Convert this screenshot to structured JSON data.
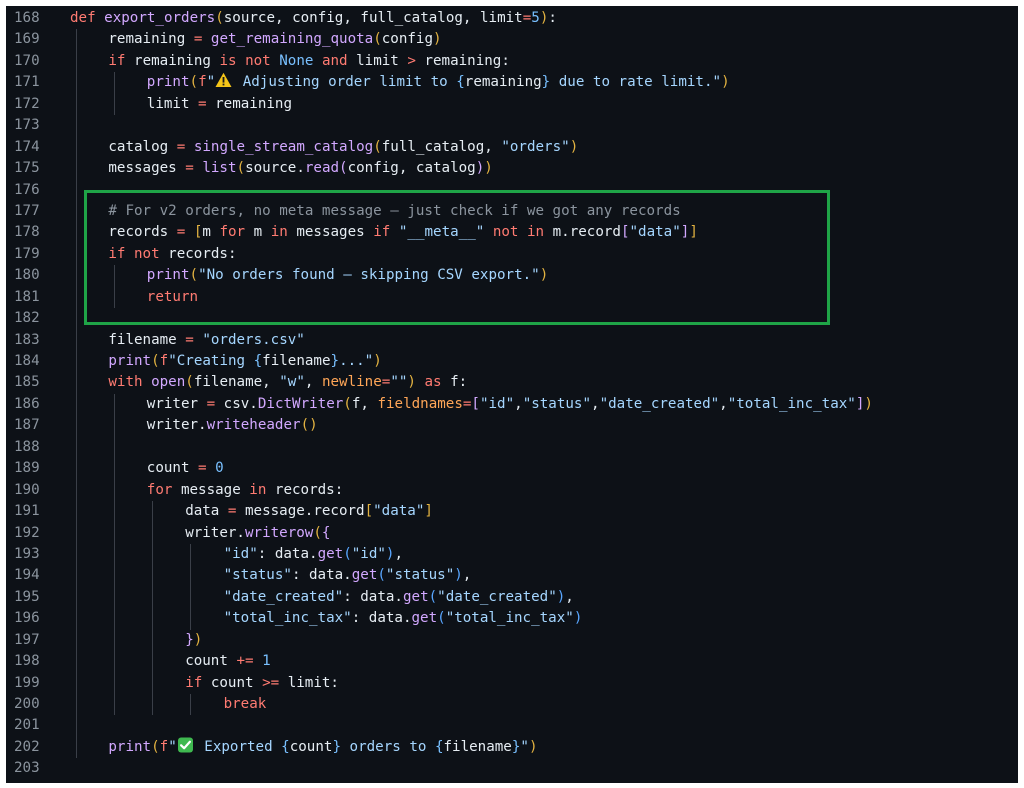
{
  "editor": {
    "theme_colors": {
      "background": "#0d1117",
      "keyword": "#ff7b72",
      "function": "#d2a8ff",
      "string": "#a5d6ff",
      "highlight_box": "#1fa447"
    },
    "lines": [
      {
        "n": "168",
        "indent": 0,
        "tokens": [
          [
            "kw",
            "def "
          ],
          [
            "fn",
            "export_orders"
          ],
          [
            "br1",
            "("
          ],
          [
            "",
            "source, config, full_catalog, limit"
          ],
          [
            "kw",
            "="
          ],
          [
            "num",
            "5"
          ],
          [
            "br1",
            ")"
          ],
          [
            "",
            ":"
          ]
        ]
      },
      {
        "n": "169",
        "indent": 1,
        "tokens": [
          [
            "",
            "remaining "
          ],
          [
            "kw",
            "="
          ],
          [
            "fn",
            " get_remaining_quota"
          ],
          [
            "br1",
            "("
          ],
          [
            "",
            "config"
          ],
          [
            "br1",
            ")"
          ]
        ]
      },
      {
        "n": "170",
        "indent": 1,
        "tokens": [
          [
            "kw",
            "if"
          ],
          [
            "",
            " remaining "
          ],
          [
            "kw",
            "is not"
          ],
          [
            "num",
            " None "
          ],
          [
            "kw",
            "and"
          ],
          [
            "",
            " limit "
          ],
          [
            "kw",
            ">"
          ],
          [
            "",
            " remaining:"
          ]
        ]
      },
      {
        "n": "171",
        "indent": 2,
        "tokens": [
          [
            "fn",
            "print"
          ],
          [
            "br1",
            "("
          ],
          [
            "kw",
            "f"
          ],
          [
            "str",
            "\""
          ],
          [
            "emoji",
            "warning"
          ],
          [
            "str",
            " Adjusting order limit to "
          ],
          [
            "num",
            "{"
          ],
          [
            "",
            "remaining"
          ],
          [
            "num",
            "}"
          ],
          [
            "str",
            " due to rate limit.\""
          ],
          [
            "br1",
            ")"
          ]
        ]
      },
      {
        "n": "172",
        "indent": 2,
        "tokens": [
          [
            "",
            "limit "
          ],
          [
            "kw",
            "="
          ],
          [
            "",
            " remaining"
          ]
        ]
      },
      {
        "n": "173",
        "indent": 0,
        "tokens": []
      },
      {
        "n": "174",
        "indent": 1,
        "tokens": [
          [
            "",
            "catalog "
          ],
          [
            "kw",
            "="
          ],
          [
            "fn",
            " single_stream_catalog"
          ],
          [
            "br1",
            "("
          ],
          [
            "",
            "full_catalog, "
          ],
          [
            "str",
            "\"orders\""
          ],
          [
            "br1",
            ")"
          ]
        ]
      },
      {
        "n": "175",
        "indent": 1,
        "tokens": [
          [
            "",
            "messages "
          ],
          [
            "kw",
            "="
          ],
          [
            "fn",
            " list"
          ],
          [
            "br1",
            "("
          ],
          [
            "",
            "source."
          ],
          [
            "fn",
            "read"
          ],
          [
            "br2",
            "("
          ],
          [
            "",
            "config, catalog"
          ],
          [
            "br2",
            ")"
          ],
          [
            "br1",
            ")"
          ]
        ]
      },
      {
        "n": "176",
        "indent": 0,
        "tokens": []
      },
      {
        "n": "177",
        "indent": 1,
        "tokens": [
          [
            "cm",
            "# For v2 orders, no meta message — just check if we got any records"
          ]
        ]
      },
      {
        "n": "178",
        "indent": 1,
        "tokens": [
          [
            "",
            "records "
          ],
          [
            "kw",
            "="
          ],
          [
            "",
            " "
          ],
          [
            "br1",
            "["
          ],
          [
            "",
            "m "
          ],
          [
            "kw",
            "for"
          ],
          [
            "",
            " m "
          ],
          [
            "kw",
            "in"
          ],
          [
            "",
            " messages "
          ],
          [
            "kw",
            "if"
          ],
          [
            "",
            " "
          ],
          [
            "str",
            "\"__meta__\""
          ],
          [
            "",
            " "
          ],
          [
            "kw",
            "not in"
          ],
          [
            "",
            " m.record"
          ],
          [
            "br2",
            "["
          ],
          [
            "str",
            "\"data\""
          ],
          [
            "br2",
            "]"
          ],
          [
            "br1",
            "]"
          ]
        ]
      },
      {
        "n": "179",
        "indent": 1,
        "tokens": [
          [
            "kw",
            "if not"
          ],
          [
            "",
            " records:"
          ]
        ]
      },
      {
        "n": "180",
        "indent": 2,
        "tokens": [
          [
            "fn",
            "print"
          ],
          [
            "br1",
            "("
          ],
          [
            "str",
            "\"No orders found – skipping CSV export.\""
          ],
          [
            "br1",
            ")"
          ]
        ]
      },
      {
        "n": "181",
        "indent": 2,
        "tokens": [
          [
            "kw",
            "return"
          ]
        ]
      },
      {
        "n": "182",
        "indent": 0,
        "tokens": []
      },
      {
        "n": "183",
        "indent": 1,
        "tokens": [
          [
            "",
            "filename "
          ],
          [
            "kw",
            "="
          ],
          [
            "str",
            " \"orders.csv\""
          ]
        ]
      },
      {
        "n": "184",
        "indent": 1,
        "tokens": [
          [
            "fn",
            "print"
          ],
          [
            "br1",
            "("
          ],
          [
            "kw",
            "f"
          ],
          [
            "str",
            "\"Creating "
          ],
          [
            "num",
            "{"
          ],
          [
            "",
            "filename"
          ],
          [
            "num",
            "}"
          ],
          [
            "str",
            "...\""
          ],
          [
            "br1",
            ")"
          ]
        ]
      },
      {
        "n": "185",
        "indent": 1,
        "tokens": [
          [
            "kw",
            "with"
          ],
          [
            "fn",
            " open"
          ],
          [
            "br1",
            "("
          ],
          [
            "",
            "filename, "
          ],
          [
            "str",
            "\"w\""
          ],
          [
            "",
            ", "
          ],
          [
            "prm",
            "newline"
          ],
          [
            "kw",
            "="
          ],
          [
            "str",
            "\"\""
          ],
          [
            "br1",
            ")"
          ],
          [
            "kw",
            " as"
          ],
          [
            "",
            " f:"
          ]
        ]
      },
      {
        "n": "186",
        "indent": 2,
        "tokens": [
          [
            "",
            "writer "
          ],
          [
            "kw",
            "="
          ],
          [
            "",
            " csv."
          ],
          [
            "fn",
            "DictWriter"
          ],
          [
            "br1",
            "("
          ],
          [
            "",
            "f, "
          ],
          [
            "prm",
            "fieldnames"
          ],
          [
            "kw",
            "="
          ],
          [
            "br2",
            "["
          ],
          [
            "str",
            "\"id\""
          ],
          [
            "",
            ","
          ],
          [
            "str",
            "\"status\""
          ],
          [
            "",
            ","
          ],
          [
            "str",
            "\"date_created\""
          ],
          [
            "",
            ","
          ],
          [
            "str",
            "\"total_inc_tax\""
          ],
          [
            "br2",
            "]"
          ],
          [
            "br1",
            ")"
          ]
        ]
      },
      {
        "n": "187",
        "indent": 2,
        "tokens": [
          [
            "",
            "writer."
          ],
          [
            "fn",
            "writeheader"
          ],
          [
            "br1",
            "()"
          ]
        ]
      },
      {
        "n": "188",
        "indent": 0,
        "tokens": []
      },
      {
        "n": "189",
        "indent": 2,
        "tokens": [
          [
            "",
            "count "
          ],
          [
            "kw",
            "="
          ],
          [
            "num",
            " 0"
          ]
        ]
      },
      {
        "n": "190",
        "indent": 2,
        "tokens": [
          [
            "kw",
            "for"
          ],
          [
            "",
            " message "
          ],
          [
            "kw",
            "in"
          ],
          [
            "",
            " records:"
          ]
        ]
      },
      {
        "n": "191",
        "indent": 3,
        "tokens": [
          [
            "",
            "data "
          ],
          [
            "kw",
            "="
          ],
          [
            "",
            " message.record"
          ],
          [
            "br1",
            "["
          ],
          [
            "str",
            "\"data\""
          ],
          [
            "br1",
            "]"
          ]
        ]
      },
      {
        "n": "192",
        "indent": 3,
        "tokens": [
          [
            "",
            "writer."
          ],
          [
            "fn",
            "writerow"
          ],
          [
            "br1",
            "("
          ],
          [
            "br2",
            "{"
          ]
        ]
      },
      {
        "n": "193",
        "indent": 4,
        "tokens": [
          [
            "str",
            "\"id\""
          ],
          [
            "",
            ": data."
          ],
          [
            "fn",
            "get"
          ],
          [
            "br3",
            "("
          ],
          [
            "str",
            "\"id\""
          ],
          [
            "br3",
            ")"
          ],
          [
            "",
            ","
          ]
        ]
      },
      {
        "n": "194",
        "indent": 4,
        "tokens": [
          [
            "str",
            "\"status\""
          ],
          [
            "",
            ": data."
          ],
          [
            "fn",
            "get"
          ],
          [
            "br3",
            "("
          ],
          [
            "str",
            "\"status\""
          ],
          [
            "br3",
            ")"
          ],
          [
            "",
            ","
          ]
        ]
      },
      {
        "n": "195",
        "indent": 4,
        "tokens": [
          [
            "str",
            "\"date_created\""
          ],
          [
            "",
            ": data."
          ],
          [
            "fn",
            "get"
          ],
          [
            "br3",
            "("
          ],
          [
            "str",
            "\"date_created\""
          ],
          [
            "br3",
            ")"
          ],
          [
            "",
            ","
          ]
        ]
      },
      {
        "n": "196",
        "indent": 4,
        "tokens": [
          [
            "str",
            "\"total_inc_tax\""
          ],
          [
            "",
            ": data."
          ],
          [
            "fn",
            "get"
          ],
          [
            "br3",
            "("
          ],
          [
            "str",
            "\"total_inc_tax\""
          ],
          [
            "br3",
            ")"
          ]
        ]
      },
      {
        "n": "197",
        "indent": 3,
        "tokens": [
          [
            "br2",
            "}"
          ],
          [
            "br1",
            ")"
          ]
        ]
      },
      {
        "n": "198",
        "indent": 3,
        "tokens": [
          [
            "",
            "count "
          ],
          [
            "kw",
            "+="
          ],
          [
            "num",
            " 1"
          ]
        ]
      },
      {
        "n": "199",
        "indent": 3,
        "tokens": [
          [
            "kw",
            "if"
          ],
          [
            "",
            " count "
          ],
          [
            "kw",
            ">="
          ],
          [
            "",
            " limit:"
          ]
        ]
      },
      {
        "n": "200",
        "indent": 4,
        "tokens": [
          [
            "kw",
            "break"
          ]
        ]
      },
      {
        "n": "201",
        "indent": 0,
        "tokens": []
      },
      {
        "n": "202",
        "indent": 1,
        "tokens": [
          [
            "fn",
            "print"
          ],
          [
            "br1",
            "("
          ],
          [
            "kw",
            "f"
          ],
          [
            "str",
            "\""
          ],
          [
            "emoji",
            "check"
          ],
          [
            "str",
            " Exported "
          ],
          [
            "num",
            "{"
          ],
          [
            "",
            "count"
          ],
          [
            "num",
            "}"
          ],
          [
            "str",
            " orders to "
          ],
          [
            "num",
            "{"
          ],
          [
            "",
            "filename"
          ],
          [
            "num",
            "}"
          ],
          [
            "str",
            "\""
          ],
          [
            "br1",
            ")"
          ]
        ]
      },
      {
        "n": "203",
        "indent": 0,
        "tokens": []
      }
    ]
  }
}
